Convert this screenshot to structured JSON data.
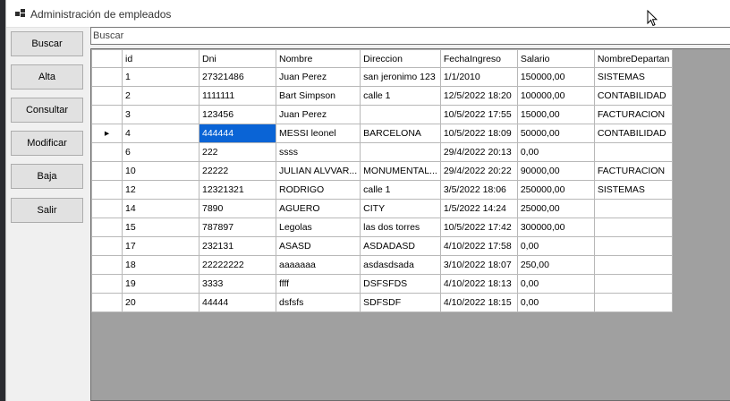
{
  "window": {
    "title": "Administración de empleados"
  },
  "buttons": [
    {
      "key": "buscar",
      "label": "Buscar"
    },
    {
      "key": "alta",
      "label": "Alta"
    },
    {
      "key": "consultar",
      "label": "Consultar"
    },
    {
      "key": "modificar",
      "label": "Modificar"
    },
    {
      "key": "baja",
      "label": "Baja"
    },
    {
      "key": "salir",
      "label": "Salir"
    }
  ],
  "search": {
    "value": "",
    "placeholder": "Buscar"
  },
  "grid": {
    "columns": [
      "id",
      "Dni",
      "Nombre",
      "Direccion",
      "FechaIngreso",
      "Salario",
      "NombreDepartan"
    ],
    "current_row_marker": "▸",
    "current_row_index": 3,
    "selected_cell": {
      "row": 3,
      "col": 1
    },
    "rows": [
      [
        "1",
        "27321486",
        "Juan Perez",
        "san jeronimo 123",
        "1/1/2010",
        "150000,00",
        "SISTEMAS"
      ],
      [
        "2",
        "1111111",
        "Bart Simpson",
        "calle 1",
        "12/5/2022 18:20",
        "100000,00",
        "CONTABILIDAD"
      ],
      [
        "3",
        "123456",
        "Juan Perez",
        "",
        "10/5/2022 17:55",
        "15000,00",
        "FACTURACION"
      ],
      [
        "4",
        "444444",
        "MESSI leonel",
        "BARCELONA",
        "10/5/2022 18:09",
        "50000,00",
        "CONTABILIDAD"
      ],
      [
        "6",
        "222",
        "ssss",
        "",
        "29/4/2022 20:13",
        "0,00",
        ""
      ],
      [
        "10",
        "22222",
        "JULIAN ALVVAR...",
        "MONUMENTAL...",
        "29/4/2022 20:22",
        "90000,00",
        "FACTURACION"
      ],
      [
        "12",
        "12321321",
        "RODRIGO",
        "calle 1",
        "3/5/2022 18:06",
        "250000,00",
        "SISTEMAS"
      ],
      [
        "14",
        "7890",
        "AGUERO",
        "CITY",
        "1/5/2022 14:24",
        "25000,00",
        ""
      ],
      [
        "15",
        "787897",
        "Legolas",
        "las dos torres",
        "10/5/2022 17:42",
        "300000,00",
        ""
      ],
      [
        "17",
        "232131",
        "ASASD",
        "ASDADASD",
        "4/10/2022 17:58",
        "0,00",
        ""
      ],
      [
        "18",
        "22222222",
        "aaaaaaa",
        "asdasdsada",
        "3/10/2022 18:07",
        "250,00",
        ""
      ],
      [
        "19",
        "3333",
        "ffff",
        "DSFSFDS",
        "4/10/2022 18:13",
        "0,00",
        ""
      ],
      [
        "20",
        "44444",
        "dsfsfs",
        "SDFSDF",
        "4/10/2022 18:15",
        "0,00",
        ""
      ]
    ]
  }
}
